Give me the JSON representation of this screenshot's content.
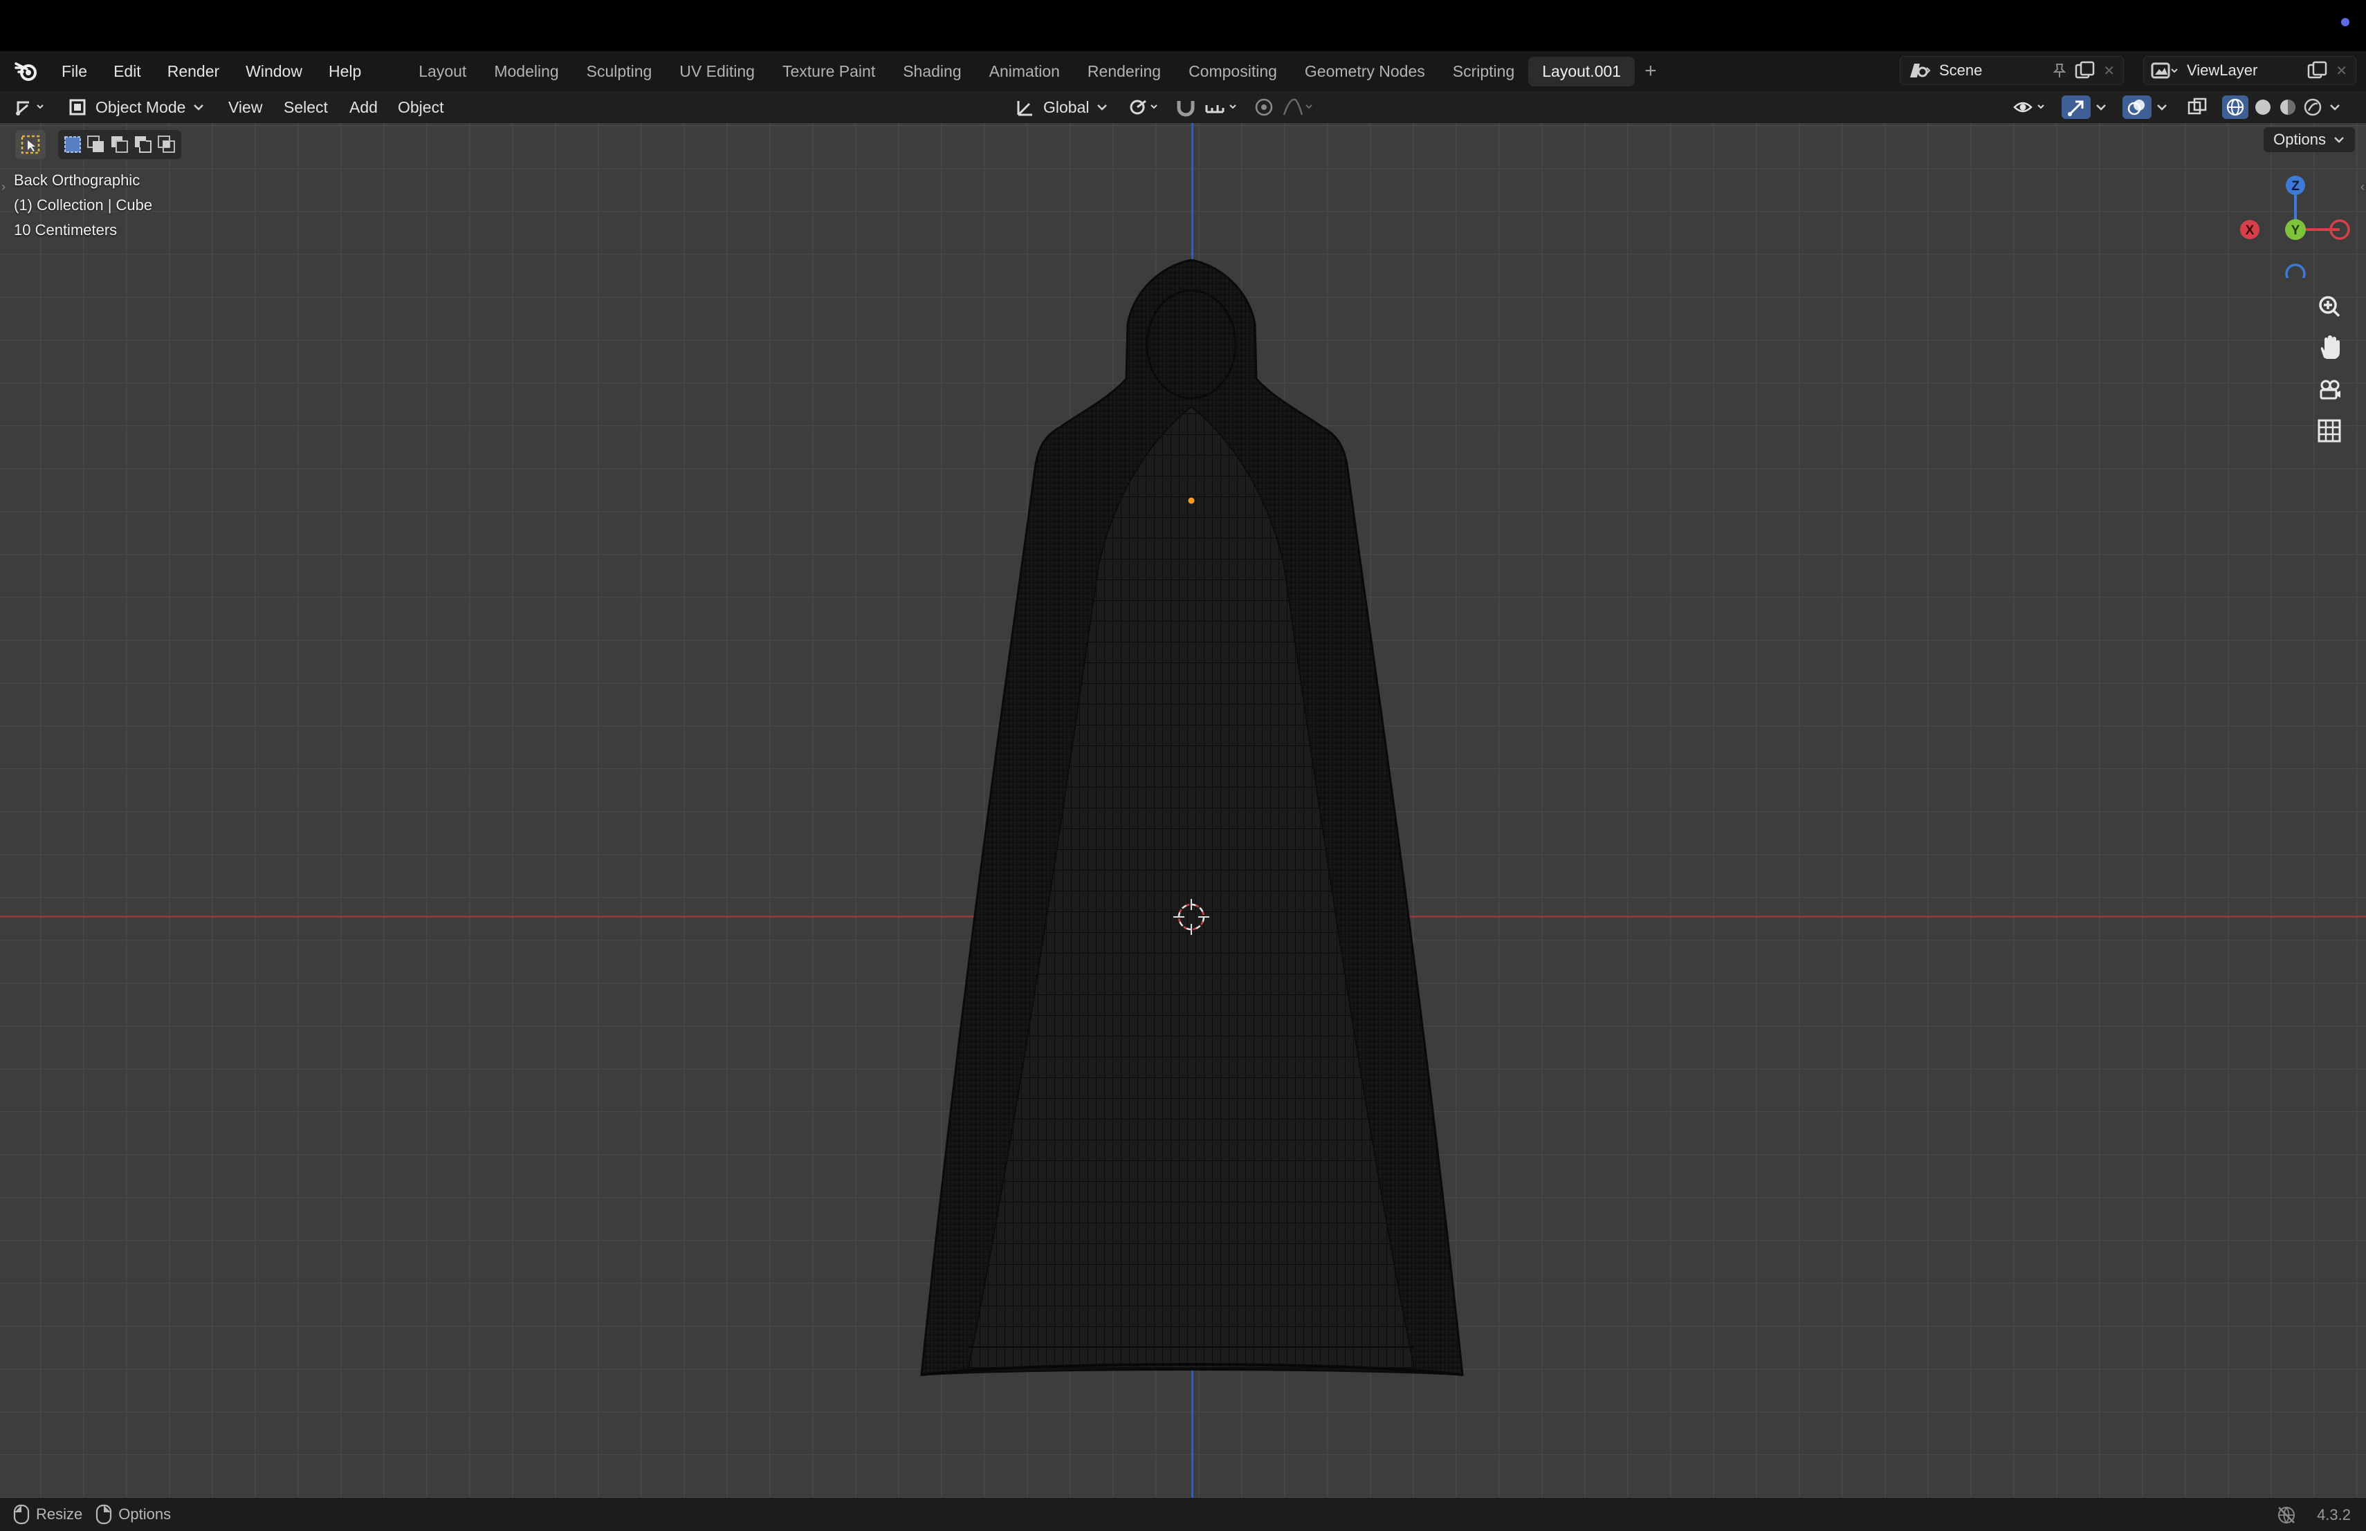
{
  "app": {
    "menu": [
      "File",
      "Edit",
      "Render",
      "Window",
      "Help"
    ],
    "workspaces": [
      "Layout",
      "Modeling",
      "Sculpting",
      "UV Editing",
      "Texture Paint",
      "Shading",
      "Animation",
      "Rendering",
      "Compositing",
      "Geometry Nodes",
      "Scripting",
      "Layout.001"
    ],
    "active_workspace": "Layout.001",
    "scene_name": "Scene",
    "view_layer": "ViewLayer"
  },
  "header": {
    "mode": "Object Mode",
    "menus": [
      "View",
      "Select",
      "Add",
      "Object"
    ],
    "transform_orientation": "Global",
    "options_label": "Options"
  },
  "viewport": {
    "view_name": "Back Orthographic",
    "collection_line": "(1) Collection | Cube",
    "grid_scale": "10 Centimeters",
    "gizmo": {
      "z": "Z",
      "x": "X",
      "y": "Y"
    },
    "colors": {
      "x_axis": "#d7404a",
      "y_axis": "#7fc33a",
      "z_axis": "#3d7ad6",
      "background": "#3d3d3d"
    },
    "object": "hooded cloak wireframe mesh"
  },
  "status": {
    "left_items": [
      "Resize",
      "Options"
    ],
    "version": "4.3.2"
  }
}
